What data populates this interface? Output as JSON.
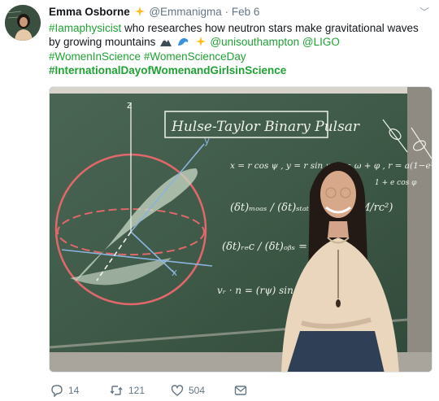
{
  "tweet": {
    "author_name": "Emma Osborne",
    "handle": "@Emmanigma",
    "separator": "·",
    "date": "Feb 6",
    "caret": "﹀",
    "hashtag1": "#Iamaphysicist",
    "text1": " who researches how neutron stars make gravitational waves by growing mountains ",
    "mention1": "@unisouthampton",
    "mention2": "@LIGO",
    "hashtag2": "#WomenInScience",
    "hashtag3": "#WomenScienceDay",
    "hashtag4": "#InternationalDayofWomenandGirlsinScience",
    "emojis": [
      "mountain-icon",
      "wave-icon",
      "sparkle-icon",
      "sparkle-icon"
    ]
  },
  "photo": {
    "board_title": "Hulse-Taylor Binary Pulsar",
    "eq1": "x = r cos ψ ,  y = r sin ψ   ψ = ω + φ ,  r = a(1−e²)/(1+e cos φ)",
    "eq2_lhs": "(δt)ₘₒₐₛ / (δt)ₛₜₐₜ = (1 − GM/rc²)",
    "eq3": "(δt)ᵣₑc / (δt)ₒᵦₛ = 1 + V/c …",
    "eq4": "vᵣ · n = (rψ) sin …",
    "axis_z": "z",
    "axis_y": "y",
    "axis_x": "x",
    "side_note": "1 + e cos φ"
  },
  "actions": {
    "reply_count": "14",
    "retweet_count": "121",
    "like_count": "504"
  },
  "colors": {
    "link": "#1fa233",
    "text": "#14171a",
    "muted": "#657786",
    "board": "#3f5848"
  }
}
